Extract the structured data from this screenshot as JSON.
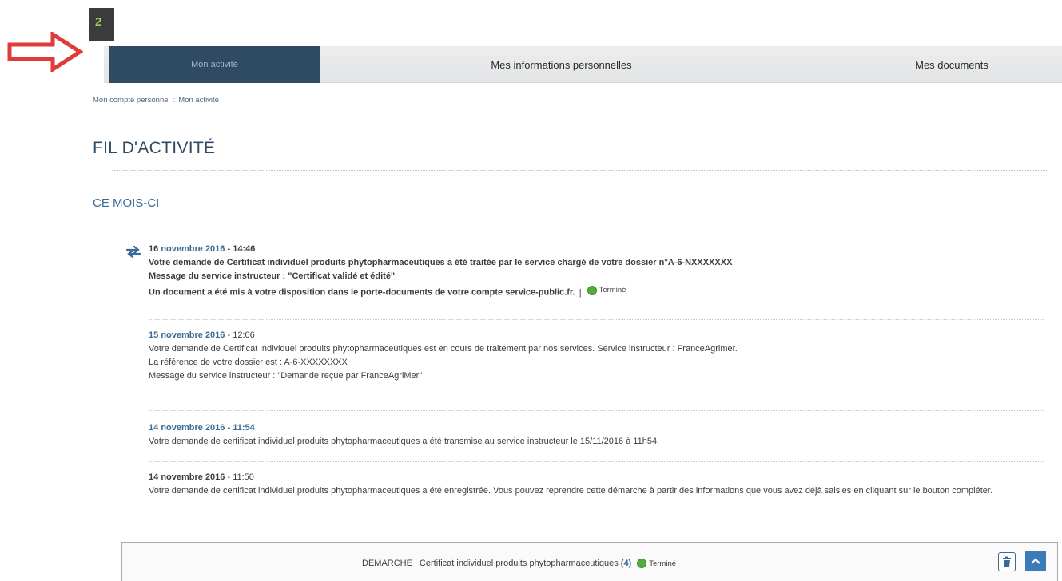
{
  "step_badge": "2",
  "tabs": [
    {
      "label": "Mon activité",
      "active": true
    },
    {
      "label": "Mes informations personnelles",
      "active": false
    },
    {
      "label": "Mes documents",
      "active": false
    }
  ],
  "breadcrumb": {
    "root": "Mon compte personnel",
    "separator": ":",
    "current": "Mon activité"
  },
  "page_title": "FIL D'ACTIVITÉ",
  "section_title": "CE MOIS-CI",
  "entries": [
    {
      "day": "16",
      "month_year": "novembre 2016",
      "time": "- 14:46",
      "lines": [
        "Votre demande de Certificat individuel produits phytopharmaceutiques a été traitée par le service chargé de votre dossier n°A-6-NXXXXXXX",
        "Message du service instructeur : \"Certificat validé et édité\"",
        "Un document a été mis à votre disposition dans le porte-documents de votre compte service-public.fr."
      ],
      "separator": "|",
      "status": "Terminé"
    },
    {
      "day": "15",
      "month_year": "novembre 2016",
      "time": "- 12:06",
      "lines": [
        "Votre demande de Certificat individuel produits phytopharmaceutiques est en cours de traitement par nos services. Service instructeur : FranceAgrimer.",
        "La référence de votre dossier est : A-6-XXXXXXXX",
        "Message du service instructeur : \"Demande reçue par FranceAgriMer\""
      ]
    },
    {
      "day": "14",
      "month_year": "novembre 2016",
      "time": "- 11:54",
      "lines": [
        "Votre demande de certificat individuel produits phytopharmaceutiques a été transmise au service instructeur le 15/11/2016 à 11h54."
      ]
    },
    {
      "day": "14",
      "month_year": "novembre 2016",
      "time": "- 11:50",
      "lines": [
        "Votre demande de certificat individuel produits phytopharmaceutiques a été enregistrée. Vous pouvez reprendre cette démarche à partir des informations que vous avez déjà saisies en cliquant sur le bouton compléter."
      ]
    }
  ],
  "demarche": {
    "label": "DEMARCHE | Certificat individuel produits phytopharmaceutiques",
    "count": "(4)",
    "status": "Terminé"
  },
  "colors": {
    "accent_dark": "#2f4a63",
    "accent_blue": "#3a6b96",
    "status_green": "#4fae3a",
    "arrow_red": "#e03a3a"
  },
  "icons": [
    "red-arrow-icon",
    "activity-exchange-icon",
    "status-done-icon",
    "trash-icon",
    "chevron-up-icon"
  ]
}
